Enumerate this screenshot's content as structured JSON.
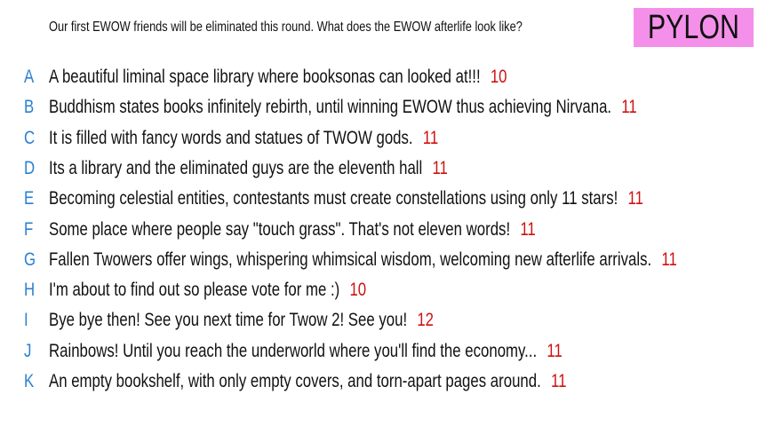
{
  "prompt": "Our first EWOW friends will be eliminated this round. What does the EWOW afterlife look like?",
  "tag": "PYLON",
  "colors": {
    "letter": "#2a7fd0",
    "count": "#d01010",
    "tag_bg": "#f490ea"
  },
  "responses": [
    {
      "letter": "A",
      "text": "A beautiful liminal space library where booksonas can looked at!!!",
      "count": "10"
    },
    {
      "letter": "B",
      "text": "Buddhism states books infinitely rebirth, until winning EWOW thus achieving Nirvana.",
      "count": "11"
    },
    {
      "letter": "C",
      "text": "It is filled with fancy words and statues of TWOW gods.",
      "count": "11"
    },
    {
      "letter": "D",
      "text": "Its a library and the eliminated guys are the eleventh hall",
      "count": "11"
    },
    {
      "letter": "E",
      "text": "Becoming celestial entities, contestants must create constellations using only 11 stars!",
      "count": "11"
    },
    {
      "letter": "F",
      "text": "Some place where people say \"touch grass\". That's not eleven words!",
      "count": "11"
    },
    {
      "letter": "G",
      "text": "Fallen Twowers offer wings, whispering whimsical wisdom, welcoming new afterlife arrivals.",
      "count": "11"
    },
    {
      "letter": "H",
      "text": "I'm about to find out so please vote for me :)",
      "count": "10"
    },
    {
      "letter": "I",
      "text": "Bye bye then! See you next time for Twow 2! See you!",
      "count": "12"
    },
    {
      "letter": "J",
      "text": "Rainbows! Until you reach the underworld where you'll find the economy...",
      "count": "11"
    },
    {
      "letter": "K",
      "text": "An empty bookshelf, with only empty covers, and torn-apart pages around.",
      "count": "11"
    }
  ]
}
